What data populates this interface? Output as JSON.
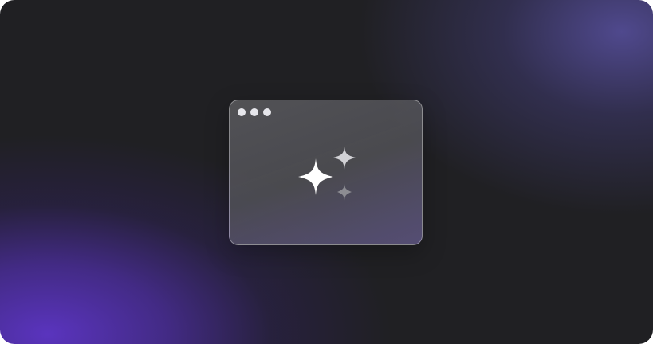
{
  "scene": {
    "background_color": "#202023",
    "accent_purple": "#5a34be",
    "accent_indigo": "#5850a0"
  },
  "window": {
    "title_dots": [
      {
        "name": "window-dot-1",
        "color": "#e6e6eb"
      },
      {
        "name": "window-dot-2",
        "color": "#e6e6eb"
      },
      {
        "name": "window-dot-3",
        "color": "#e6e6eb"
      }
    ],
    "icon": "sparkles-icon",
    "icon_colors": {
      "large": "#ffffff",
      "medium": "#d2d2d6",
      "small": "#8c8c92"
    }
  }
}
